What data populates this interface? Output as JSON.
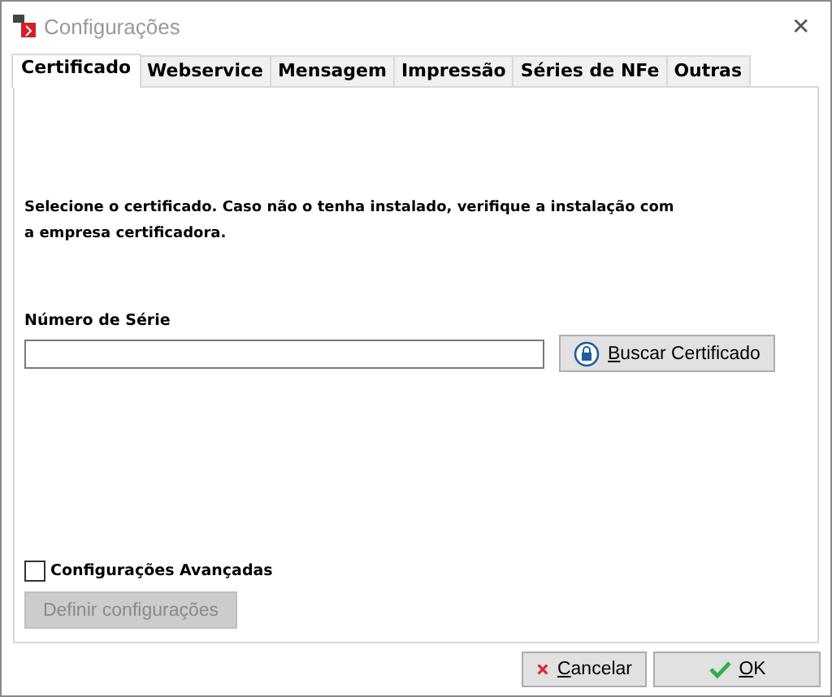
{
  "window": {
    "title": "Configurações",
    "close": "✕"
  },
  "tabs": [
    {
      "label": "Certificado",
      "selected": true
    },
    {
      "label": "Webservice",
      "selected": false
    },
    {
      "label": "Mensagem",
      "selected": false
    },
    {
      "label": "Impressão",
      "selected": false
    },
    {
      "label": "Séries de NFe",
      "selected": false
    },
    {
      "label": "Outras",
      "selected": false
    }
  ],
  "instructions": "Selecione o certificado. Caso não o tenha instalado, verifique a instalação com a empresa certificadora.",
  "serial": {
    "label": "Número de Série"
  },
  "search_button": {
    "label": "Buscar Certificado"
  },
  "advanced": {
    "label": "Configurações Avançadas",
    "checked": false
  },
  "define_button": {
    "label": "Definir configurações",
    "disabled": true
  },
  "buttons": [
    {
      "kind": "cancel",
      "label": "Cancelar"
    },
    {
      "kind": "ok",
      "label": "OK"
    }
  ]
}
